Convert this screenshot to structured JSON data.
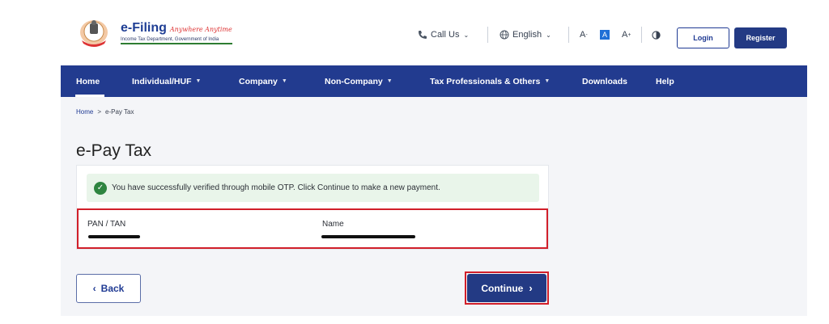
{
  "header": {
    "brand_title": "e-Filing",
    "brand_tagline": "Anywhere Anytime",
    "brand_subtitle": "Income Tax Department, Government of India",
    "call_us": "Call Us",
    "language": "English",
    "font_decrease": "A",
    "font_normal": "A",
    "font_increase": "A",
    "login": "Login",
    "register": "Register"
  },
  "nav": {
    "items": [
      {
        "label": "Home",
        "dropdown": false
      },
      {
        "label": "Individual/HUF",
        "dropdown": true
      },
      {
        "label": "Company",
        "dropdown": true
      },
      {
        "label": "Non-Company",
        "dropdown": true
      },
      {
        "label": "Tax Professionals & Others",
        "dropdown": true
      },
      {
        "label": "Downloads",
        "dropdown": false
      },
      {
        "label": "Help",
        "dropdown": false
      }
    ]
  },
  "breadcrumb": {
    "home": "Home",
    "separator": ">",
    "current": "e-Pay Tax"
  },
  "page": {
    "title": "e-Pay Tax",
    "success_message": "You have successfully verified through mobile OTP. Click Continue to make a new payment.",
    "pan_label": "PAN / TAN",
    "name_label": "Name"
  },
  "actions": {
    "back": "Back",
    "continue": "Continue"
  },
  "colors": {
    "primary": "#223b8f",
    "highlight": "#d11f2a",
    "success": "#2e8540"
  }
}
